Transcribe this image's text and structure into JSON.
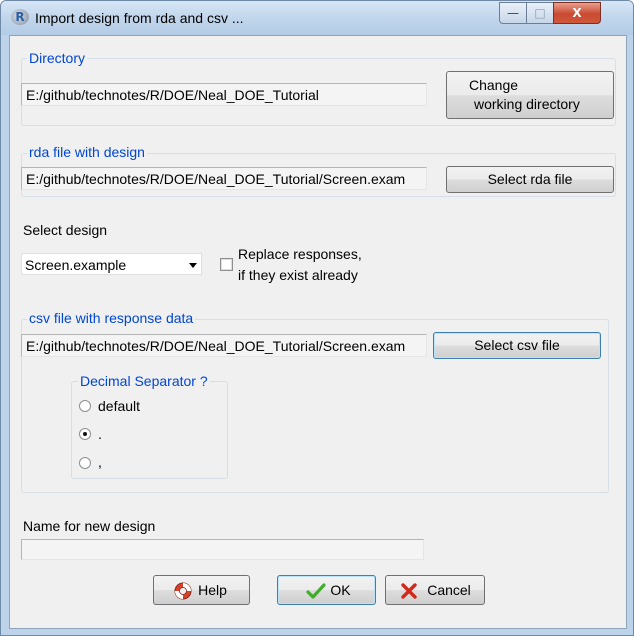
{
  "window": {
    "title": "Import design from rda and csv ...",
    "app_icon": "R",
    "minimize_glyph": "—",
    "maximize_glyph": "□",
    "close_glyph": "X"
  },
  "directory": {
    "group_title": "Directory",
    "path": "E:/github/technotes/R/DOE/Neal_DOE_Tutorial",
    "change_button_line1": "Change",
    "change_button_line2": "working directory"
  },
  "rda": {
    "group_title": "rda file with design",
    "path": "E:/github/technotes/R/DOE/Neal_DOE_Tutorial/Screen.exam",
    "select_button": "Select rda file"
  },
  "design": {
    "label": "Select design",
    "selected": "Screen.example",
    "replace_line1": "Replace responses,",
    "replace_line2": "if they exist already",
    "replace_checked": false
  },
  "csv": {
    "group_title": "csv file with response data",
    "path": "E:/github/technotes/R/DOE/Neal_DOE_Tutorial/Screen.exam",
    "select_button": "Select csv file",
    "decimal_group_title": "Decimal Separator ?",
    "options": [
      {
        "label": "default",
        "checked": false
      },
      {
        "label": ".",
        "checked": true
      },
      {
        "label": ",",
        "checked": false
      }
    ]
  },
  "new_design": {
    "label": "Name for new design",
    "value": ""
  },
  "buttons": {
    "help": "Help",
    "ok": "OK",
    "cancel": "Cancel"
  },
  "colors": {
    "group_title": "#0046d5",
    "ok_check": "#3fae2a",
    "cancel_x": "#d02a1a"
  },
  "icons": {
    "help": "lifebuoy-icon",
    "ok": "checkmark-icon",
    "cancel": "red-x-icon"
  }
}
